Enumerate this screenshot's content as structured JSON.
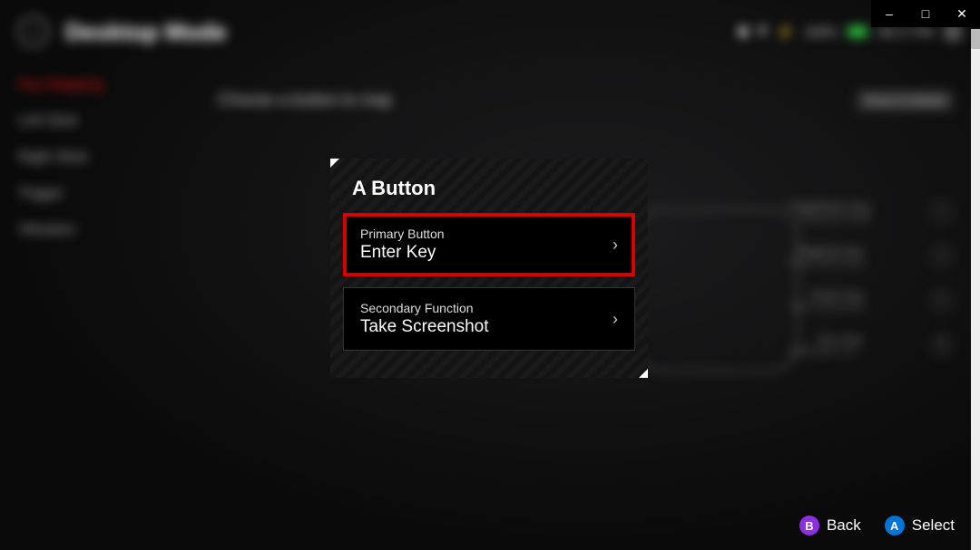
{
  "window": {
    "minimize": "–",
    "maximize": "□",
    "close": "✕"
  },
  "header": {
    "title": "Desktop Mode",
    "battery_pct": "100%",
    "time": "06:17 PM"
  },
  "sidebar": {
    "items": [
      {
        "label": "Key Mapping",
        "active": true
      },
      {
        "label": "Left Stick"
      },
      {
        "label": "Right Stick"
      },
      {
        "label": "Trigger"
      },
      {
        "label": "Vibration"
      }
    ]
  },
  "page": {
    "subtitle": "Choose a button to map",
    "reset": "Reset to Default"
  },
  "bg_mappings": [
    {
      "key": "PageDown Key",
      "fn": "Projection Mode"
    },
    {
      "key": "PageUp Key",
      "fn": "Begin Recording"
    },
    {
      "key": "Enter Key",
      "fn": "Take Screenshot"
    },
    {
      "key": "Esc Key",
      "fn": "Notification Ce..."
    }
  ],
  "dialog": {
    "title": "A Button",
    "primary": {
      "label": "Primary Button",
      "value": "Enter Key"
    },
    "secondary": {
      "label": "Secondary Function",
      "value": "Take Screenshot"
    }
  },
  "hints": {
    "back": {
      "glyph": "B",
      "label": "Back"
    },
    "select": {
      "glyph": "A",
      "label": "Select"
    }
  }
}
